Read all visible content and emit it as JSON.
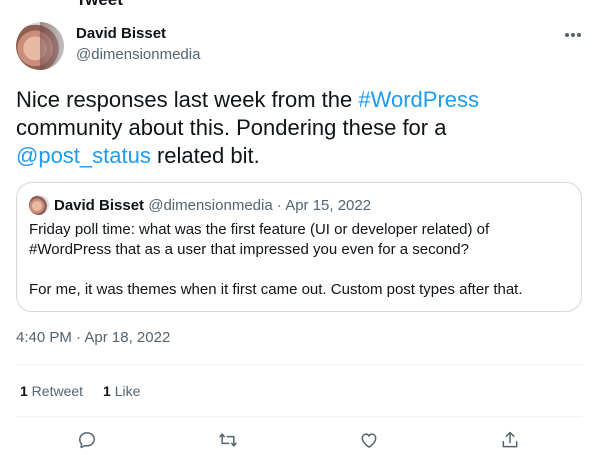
{
  "header_cut_text": "Tweet",
  "author": {
    "name": "David Bisset",
    "handle": "@dimensionmedia"
  },
  "tweet": {
    "text_1": "Nice responses last week from the ",
    "hashtag": "#WordPress",
    "text_2": " community about this. Pondering these for a ",
    "mention": "@post_status",
    "text_3": " related bit."
  },
  "quoted": {
    "name": "David Bisset",
    "handle": "@dimensionmedia",
    "separator": " · ",
    "date": "Apr 15, 2022",
    "paragraph_1": "Friday poll time: what was the first feature (UI or developer related) of #WordPress that as a user that impressed you even for a second?",
    "paragraph_2": "For me, it was themes when it first came out. Custom post types after that."
  },
  "meta": {
    "time": "4:40 PM",
    "separator": " · ",
    "date": "Apr 18, 2022"
  },
  "stats": {
    "retweets_count": "1",
    "retweets_label": " Retweet",
    "likes_count": "1",
    "likes_label": " Like"
  },
  "actions": {
    "reply_icon": "reply-icon",
    "retweet_icon": "retweet-icon",
    "like_icon": "like-icon",
    "share_icon": "share-icon"
  },
  "colors": {
    "link": "#1d9bf0",
    "text": "#0f1419",
    "secondary": "#536471",
    "border": "#cfd9de"
  }
}
